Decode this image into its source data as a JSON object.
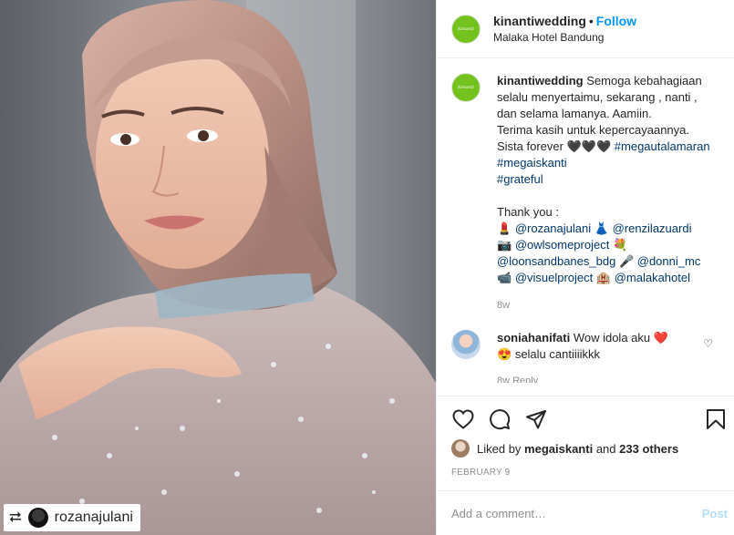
{
  "photo": {
    "repost_icon": "repost-icon",
    "repost_username": "rozanajulani"
  },
  "header": {
    "avatar_text": "kinanti",
    "username": "kinantiwedding",
    "separator": "•",
    "follow_label": "Follow",
    "location": "Malaka Hotel Bandung"
  },
  "caption": {
    "avatar_text": "kinanti",
    "username": "kinantiwedding",
    "lines": [
      "Semoga kebahagiaan",
      "selalu menyertaimu, sekarang , nanti ,",
      "dan selama lamanya. Aamiin.",
      "Terima kasih untuk kepercayaannya.",
      "Sista forever 🖤🖤🖤"
    ],
    "tags": [
      "#megautalamaran",
      "#megaiskanti",
      "#grateful"
    ],
    "thank_you": "Thank you :",
    "credits": [
      {
        "emoji": "💄",
        "handle": "@rozanajulani"
      },
      {
        "emoji": "👗",
        "handle": "@renzilazuardi"
      },
      {
        "emoji": "📷",
        "handle": "@owlsomeproject"
      },
      {
        "emoji": "💐",
        "handle": ""
      },
      {
        "emoji": "",
        "handle": "@loonsandbanes_bdg"
      },
      {
        "emoji": "🎤",
        "handle": "@donni_mc"
      },
      {
        "emoji": "📹",
        "handle": "@visuelproject"
      },
      {
        "emoji": "🏨",
        "handle": "@malakahotel"
      }
    ],
    "time": "8w"
  },
  "comment": {
    "username": "soniahanifati",
    "text": "Wow idola aku",
    "emoji1": "❤️",
    "emoji2": "😍",
    "text2": "selalu cantiiiikkk",
    "like_icon": "heart-outline-icon",
    "more_text": "8w  Reply"
  },
  "actions": {
    "like_icon": "heart-outline-icon",
    "comment_icon": "comment-icon",
    "share_icon": "share-icon",
    "save_icon": "bookmark-icon"
  },
  "likes": {
    "prefix": "Liked by",
    "user": "megaiskanti",
    "and": "and",
    "others": "233 others"
  },
  "date": "FEBRUARY 9",
  "add_comment": {
    "placeholder": "Add a comment…",
    "post_label": "Post"
  },
  "colors": {
    "brand_green": "#74c21d",
    "link_blue": "#0095f6",
    "tag_blue": "#00376b",
    "post_disabled": "#b2dffc"
  }
}
